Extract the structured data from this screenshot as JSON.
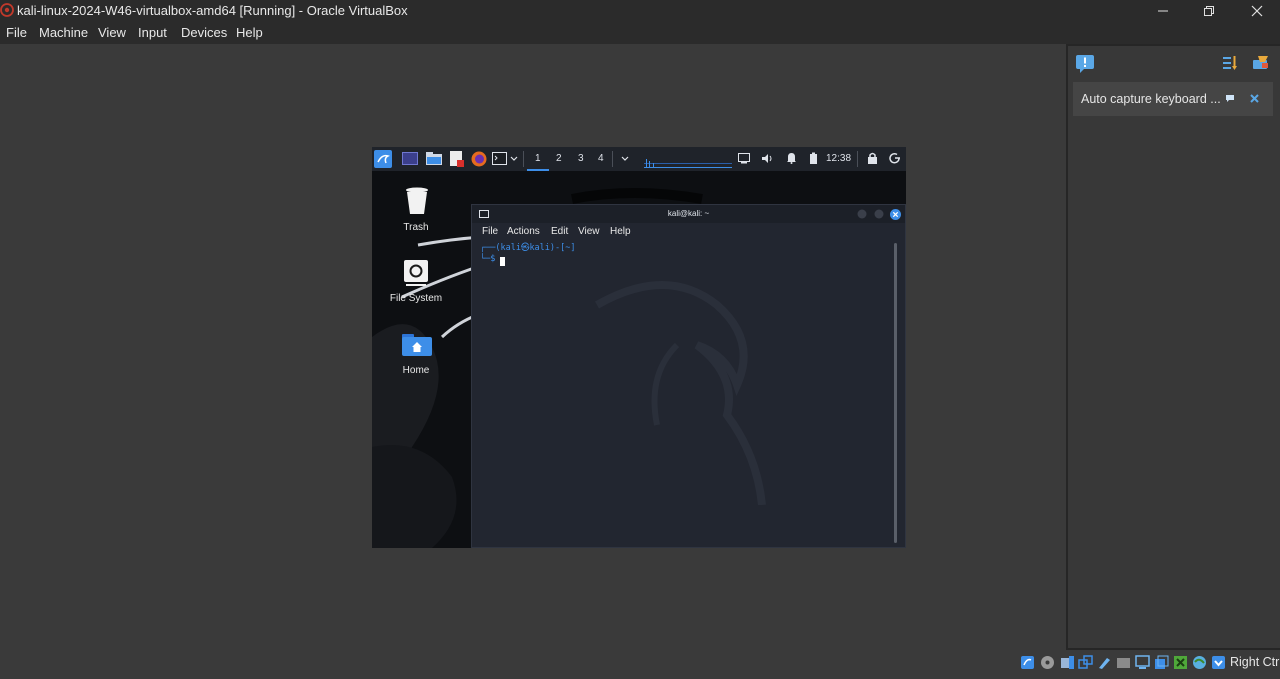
{
  "window": {
    "title": "kali-linux-2024-W46-virtualbox-amd64 [Running] - Oracle VirtualBox",
    "app_icon": "virtualbox-icon"
  },
  "menubar": {
    "items": [
      "File",
      "Machine",
      "View",
      "Input",
      "Devices",
      "Help"
    ]
  },
  "notification_panel": {
    "message": "Auto capture keyboard ...",
    "icons": [
      "notification-icon",
      "sort-icon",
      "settings-clean-icon",
      "pin-icon",
      "close-icon"
    ]
  },
  "statusbar": {
    "host_key": "Right Ctrl",
    "icons": [
      "hard-disk-icon",
      "optical-drive-icon",
      "audio-icon",
      "network-icon",
      "usb-icon",
      "shared-folders-icon",
      "display-icon",
      "recording-icon",
      "guest-additions-icon",
      "cpu-icon",
      "mouse-integration-icon",
      "keyboard-icon"
    ]
  },
  "guest": {
    "panel": {
      "workspaces": [
        "1",
        "2",
        "3",
        "4"
      ],
      "clock": "12:38"
    },
    "desktop_icons": [
      {
        "label": "Trash",
        "icon": "trash-icon"
      },
      {
        "label": "File System",
        "icon": "drive-icon"
      },
      {
        "label": "Home",
        "icon": "home-folder-icon"
      }
    ],
    "terminal": {
      "title": "kali@kali: ~",
      "menu": [
        "File",
        "Actions",
        "Edit",
        "View",
        "Help"
      ],
      "prompt_line1": "┌──(kali㉿kali)-[~]",
      "prompt_line2": "└─$ "
    }
  },
  "colors": {
    "host_bg": "#3a3a3a",
    "chrome": "#2b2b2b",
    "kali_accent": "#3d8ee8"
  }
}
